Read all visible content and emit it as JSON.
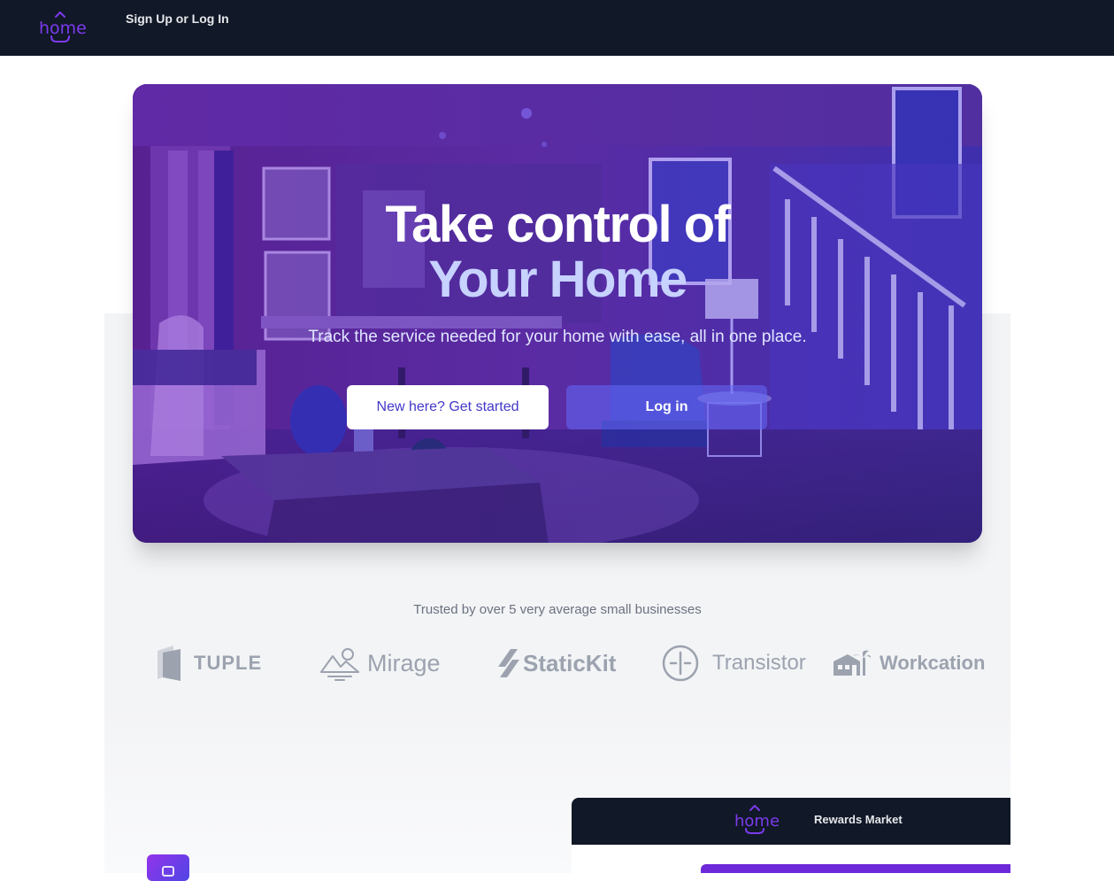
{
  "nav": {
    "logo_text": "home",
    "link": "Sign Up or Log In"
  },
  "hero": {
    "title_line1": "Take control of",
    "title_line2": "Your Home",
    "subtitle": "Track the service needed for your home with ease, all in one place.",
    "primary_button": "New here? Get started",
    "secondary_button": "Log in"
  },
  "logos": {
    "caption": "Trusted by over 5 very average small businesses",
    "items": [
      {
        "name": "TUPLE",
        "icon": "tuple-logo-icon"
      },
      {
        "name": "Mirage",
        "icon": "mirage-logo-icon"
      },
      {
        "name": "StaticKit",
        "icon": "statickit-logo-icon"
      },
      {
        "name": "Transistor",
        "icon": "transistor-logo-icon"
      },
      {
        "name": "Workcation",
        "icon": "workcation-logo-icon"
      }
    ]
  },
  "preview": {
    "logo_text": "home",
    "link": "Rewards Market"
  },
  "colors": {
    "nav_bg": "#111827",
    "brand_purple": "#7c3aed",
    "hero_title_accent": "#c7d2fe",
    "button_text": "#4338ca",
    "logo_gray": "#9ca3af"
  }
}
